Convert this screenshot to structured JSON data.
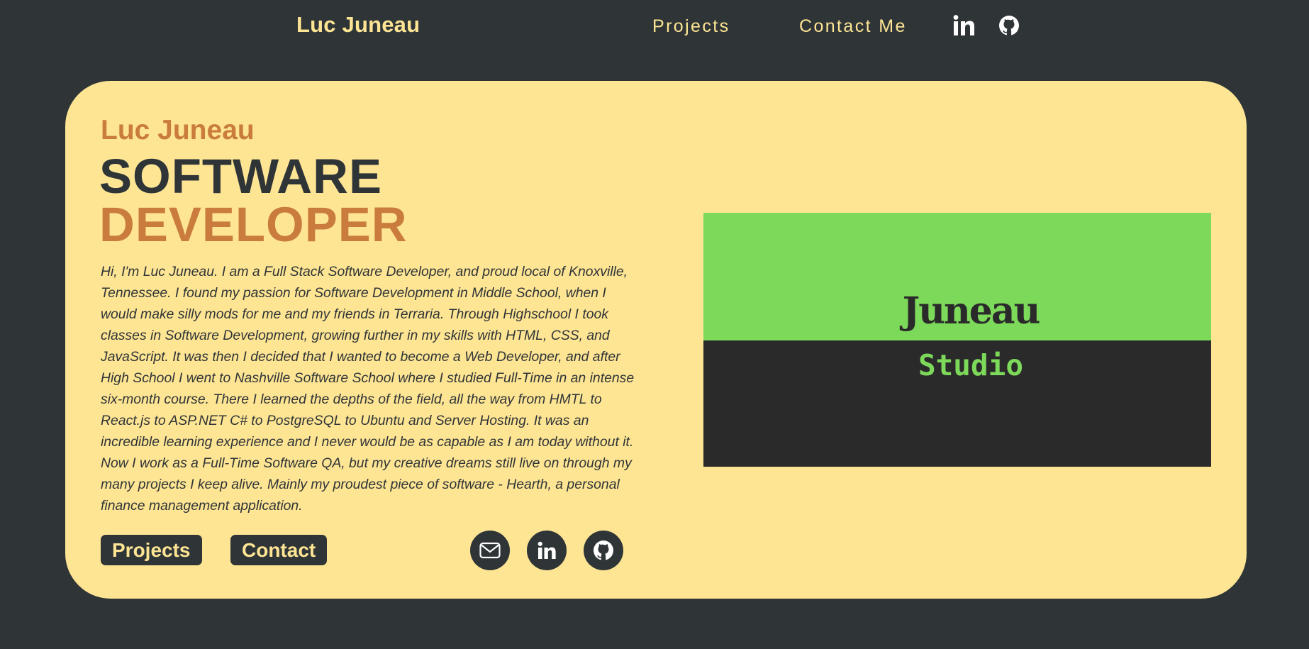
{
  "nav": {
    "brand": "Luc Juneau",
    "links": [
      "Projects",
      "Contact Me"
    ],
    "icons": [
      "linkedin-icon",
      "github-icon"
    ],
    "text_color": "#fde594"
  },
  "hero": {
    "name": "Luc Juneau",
    "title_line1": "SOFTWARE",
    "title_line2": "DEVELOPER",
    "bio": "Hi, I'm Luc Juneau. I am a Full Stack Software Developer, and proud local of Knoxville, Tennessee. I found my passion for Software Development in Middle School, when I would make silly mods for me and my friends in Terraria. Through Highschool I took classes in Software Development, growing further in my skills with HTML, CSS, and JavaScript. It was then I decided that I wanted to become a Web Developer, and after High School I went to Nashville Software School where I studied Full-Time in an intense six-month course. There I learned the depths of the field, all the way from HMTL to React.js to ASP.NET C# to PostgreSQL to Ubuntu and Server Hosting. It was an incredible learning experience and I never would be as capable as I am today without it. Now I work as a Full-Time Software QA, but my creative dreams still live on through my many projects I keep alive. Mainly my proudest piece of software - Hearth, a personal finance management application.",
    "buttons": [
      "Projects",
      "Contact"
    ],
    "social_icons": [
      "mail-icon",
      "linkedin-icon",
      "github-icon"
    ]
  },
  "logo": {
    "word1": "Juneau",
    "word2": "Studio",
    "green": "#7dd95a",
    "dark": "#2a2a2b"
  },
  "colors": {
    "background": "#2f3437",
    "card": "#fee594",
    "accent": "#c97c3d",
    "text_dark": "#2f3437"
  }
}
